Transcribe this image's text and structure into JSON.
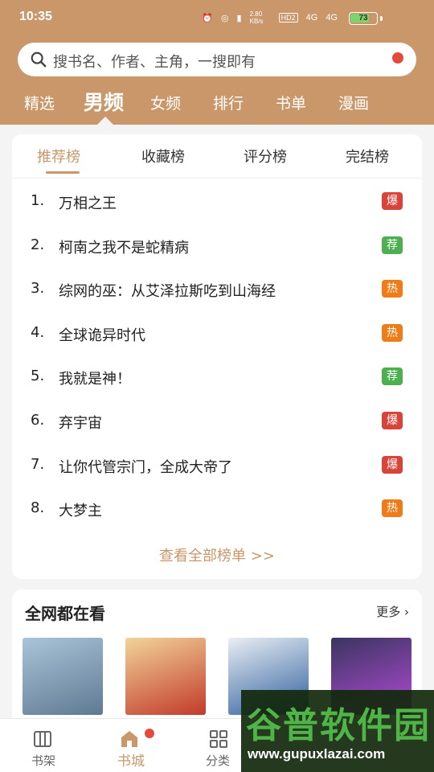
{
  "status_bar": {
    "time": "10:35",
    "net_speed": "2.80 KB/s",
    "hd": "HD2",
    "signal_1": "4G",
    "signal_2": "4G",
    "battery": "73",
    "battery_level": 0.73
  },
  "search": {
    "placeholder": "搜书名、作者、主角，一搜即有"
  },
  "category_tabs": [
    {
      "label": "精选",
      "active": false
    },
    {
      "label": "男频",
      "active": true
    },
    {
      "label": "女频",
      "active": false
    },
    {
      "label": "排行",
      "active": false
    },
    {
      "label": "书单",
      "active": false
    },
    {
      "label": "漫画",
      "active": false
    }
  ],
  "ranking": {
    "tabs": [
      {
        "label": "推荐榜",
        "active": true
      },
      {
        "label": "收藏榜",
        "active": false
      },
      {
        "label": "评分榜",
        "active": false
      },
      {
        "label": "完结榜",
        "active": false
      }
    ],
    "items": [
      {
        "rank": "1.",
        "title": "万相之王",
        "badge": "爆",
        "badge_color": "#d9443a"
      },
      {
        "rank": "2.",
        "title": "柯南之我不是蛇精病",
        "badge": "荐",
        "badge_color": "#4caf50"
      },
      {
        "rank": "3.",
        "title": "综网的巫：从艾泽拉斯吃到山海经",
        "badge": "热",
        "badge_color": "#f07c17"
      },
      {
        "rank": "4.",
        "title": "全球诡异时代",
        "badge": "热",
        "badge_color": "#f07c17"
      },
      {
        "rank": "5.",
        "title": "我就是神！",
        "badge": "荐",
        "badge_color": "#4caf50"
      },
      {
        "rank": "6.",
        "title": "弃宇宙",
        "badge": "爆",
        "badge_color": "#d9443a"
      },
      {
        "rank": "7.",
        "title": "让你代管宗门，全成大帝了",
        "badge": "爆",
        "badge_color": "#d9443a"
      },
      {
        "rank": "8.",
        "title": "大梦主",
        "badge": "热",
        "badge_color": "#f07c17"
      }
    ],
    "view_all": "查看全部榜单 >>"
  },
  "watching": {
    "title": "全网都在看",
    "more": "更多",
    "books": [
      {
        "cover_colors": [
          "#aac4d8",
          "#5e7a93"
        ]
      },
      {
        "cover_colors": [
          "#f2d49a",
          "#c23a2a"
        ]
      },
      {
        "cover_colors": [
          "#e9eef4",
          "#2d5e9c"
        ]
      },
      {
        "cover_colors": [
          "#3a3560",
          "#b24bd6"
        ]
      }
    ]
  },
  "bottom_nav": [
    {
      "label": "书架",
      "icon": "bookshelf-icon",
      "active": false
    },
    {
      "label": "书城",
      "icon": "bookstore-icon",
      "active": true
    },
    {
      "label": "分类",
      "icon": "category-icon",
      "active": false
    }
  ],
  "watermark": {
    "brand": "谷普软件园",
    "url": "www.gupuxlazai.com"
  }
}
